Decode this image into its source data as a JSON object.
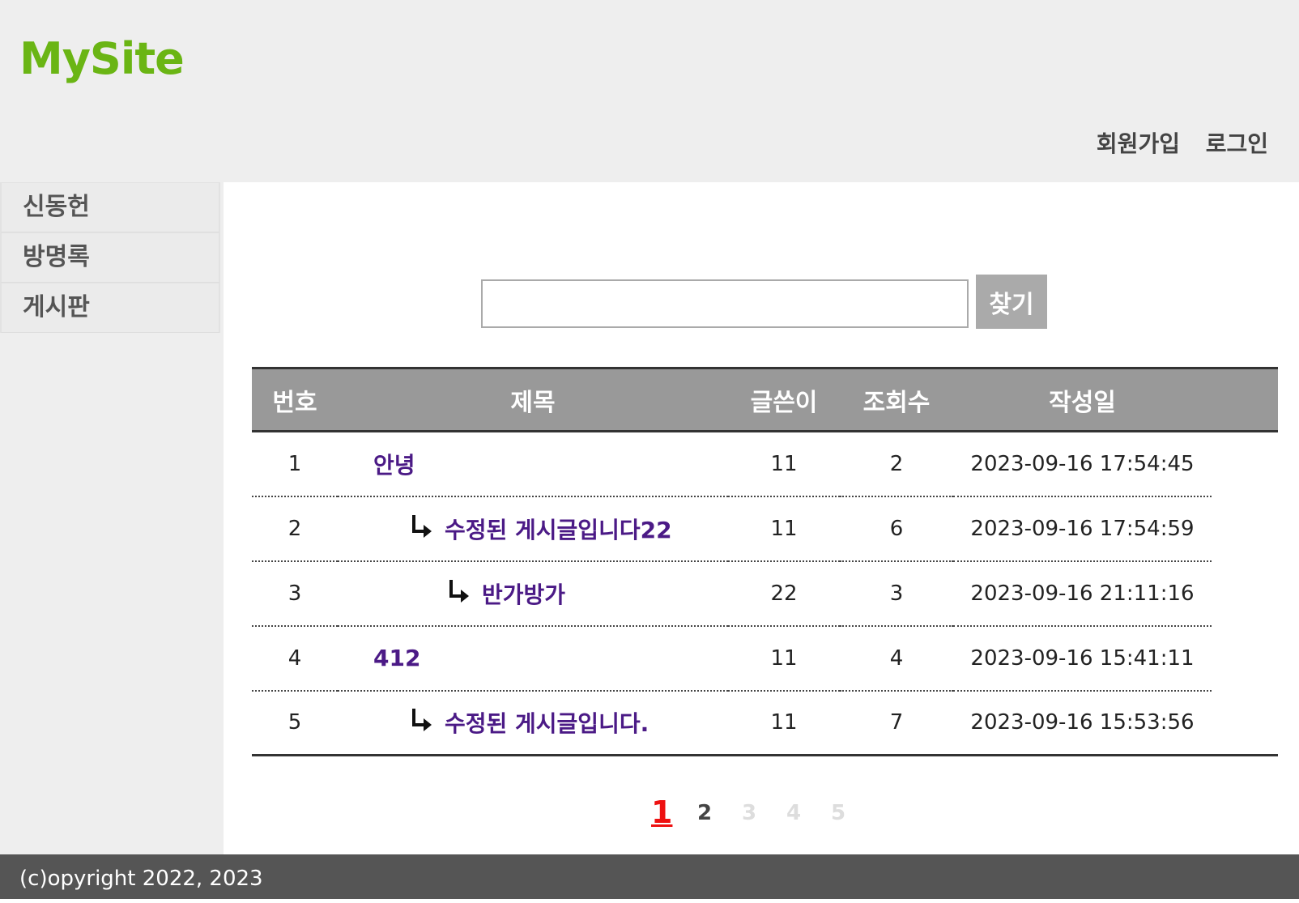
{
  "header": {
    "logo": "MySite",
    "join_label": "회원가입",
    "login_label": "로그인"
  },
  "nav": {
    "items": [
      {
        "label": "신동헌"
      },
      {
        "label": "방명록"
      },
      {
        "label": "게시판"
      }
    ]
  },
  "search": {
    "value": "",
    "button_label": "찾기"
  },
  "board": {
    "columns": [
      "번호",
      "제목",
      "글쓴이",
      "조회수",
      "작성일"
    ],
    "rows": [
      {
        "no": "1",
        "title": "안녕",
        "depth": 0,
        "writer": "11",
        "hits": "2",
        "date": "2023-09-16 17:54:45"
      },
      {
        "no": "2",
        "title": "수정된 게시글입니다22",
        "depth": 1,
        "writer": "11",
        "hits": "6",
        "date": "2023-09-16 17:54:59"
      },
      {
        "no": "3",
        "title": "반가방가",
        "depth": 2,
        "writer": "22",
        "hits": "3",
        "date": "2023-09-16 21:11:16"
      },
      {
        "no": "4",
        "title": "412",
        "depth": 0,
        "writer": "11",
        "hits": "4",
        "date": "2023-09-16 15:41:11"
      },
      {
        "no": "5",
        "title": "수정된 게시글입니다.",
        "depth": 1,
        "writer": "11",
        "hits": "7",
        "date": "2023-09-16 15:53:56"
      }
    ]
  },
  "pager": {
    "pages": [
      {
        "label": "1",
        "state": "current"
      },
      {
        "label": "2",
        "state": "link"
      },
      {
        "label": "3",
        "state": "disabled"
      },
      {
        "label": "4",
        "state": "disabled"
      },
      {
        "label": "5",
        "state": "disabled"
      }
    ]
  },
  "footer": {
    "copyright": "(c)opyright 2022, 2023"
  },
  "colors": {
    "logo": "#6ab514",
    "title_link": "#4b1a86",
    "current_page": "#ee1111",
    "table_header_bg": "#999999",
    "footer_bg": "#555555"
  }
}
